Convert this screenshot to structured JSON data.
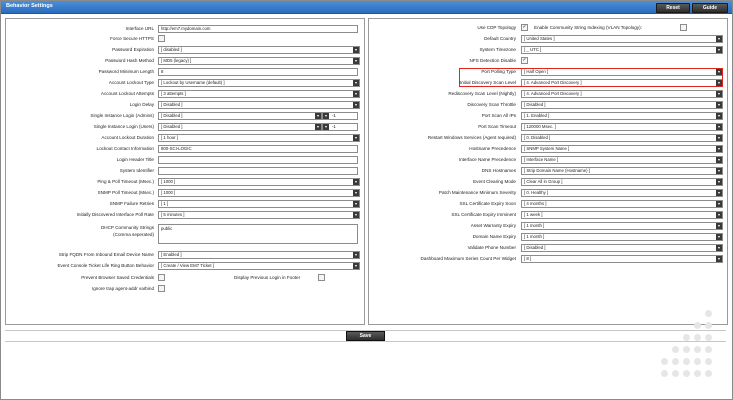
{
  "window": {
    "title": "Behavior Settings",
    "reset_label": "Reset",
    "guide_label": "Guide"
  },
  "left": {
    "interface_url": {
      "label": "Interface URL",
      "value": "http://em7.mydomain.com"
    },
    "force_https": {
      "label": "Force Secure HTTPS"
    },
    "password_expiration": {
      "label": "Password Expiration",
      "value": "[ disabled ]"
    },
    "password_hash": {
      "label": "Password Hash Method",
      "value": "[ MD5 (legacy) ]"
    },
    "password_min_length": {
      "label": "Password Minimum Length",
      "value": "8"
    },
    "account_lockout_type": {
      "label": "Account Lockout Type",
      "value": "[ Lockout by Username (default) ]"
    },
    "account_lockout_attempts": {
      "label": "Account Lockout Attempts",
      "value": "[ 3 attempts ]"
    },
    "login_delay": {
      "label": "Login Delay",
      "value": "[ Disabled ]"
    },
    "single_login_admins": {
      "label": "Single Instance Login (Admins)",
      "value": "[ Disabled ]",
      "extra": "-1"
    },
    "single_login_users": {
      "label": "Single Instance Login (Users)",
      "value": "[ Disabled ]",
      "extra": "-1"
    },
    "account_lockout_duration": {
      "label": "Account Lockout Duration",
      "value": "[ 1 hour ]"
    },
    "lockout_contact": {
      "label": "Lockout Contact Information",
      "value": "800-SCI-LOGIC"
    },
    "login_header_title": {
      "label": "Login Header Title",
      "value": ""
    },
    "system_identifier": {
      "label": "System Identifier",
      "value": ""
    },
    "ping_timeout": {
      "label": "Ping & Poll Timeout (Msec.)",
      "value": "[ 1000 ]"
    },
    "snmp_timeout": {
      "label": "SNMP Poll Timeout (Msec.)",
      "value": "[ 1000 ]"
    },
    "snmp_retries": {
      "label": "SNMP Failure Retries",
      "value": "[ 1 ]"
    },
    "poll_rate": {
      "label": "Initially Discovered Interface Poll Rate",
      "value": "[ 5 minutes ]"
    },
    "dhcp_strings": {
      "label": "DHCP Community Strings",
      "label2": "(Comma seperated)",
      "value": "public"
    },
    "strip_fqdn": {
      "label": "Strip FQDN From Inbound Email Device Name",
      "value": "[ Enabled ]"
    },
    "event_console": {
      "label": "Event Console Ticket Life Ring Button Behavior",
      "value": "[ Create / View EM7 Ticket ]"
    },
    "prevent_browser": {
      "label": "Prevent Browser Saved Credentials"
    },
    "display_prev_login": {
      "label": "Display Previous Login in Footer"
    },
    "ignore_trap": {
      "label": "Ignore trap agent-addr varbind"
    }
  },
  "right": {
    "use_cdp": {
      "label": "Use CDP Topology",
      "checked_mark": "✓"
    },
    "community_indexing": {
      "label": "Enable Community String Indexing (VLAN Topology):"
    },
    "default_country": {
      "label": "Default Country",
      "value": "[ United States ]"
    },
    "system_timezone": {
      "label": "System Timezone",
      "value": "[ _ UTC ]"
    },
    "nfs_detection": {
      "label": "NFS Detection Disable",
      "checked_mark": "✓"
    },
    "port_polling": {
      "label": "Port Polling Type",
      "value": "[ Half Open ]"
    },
    "initial_scan": {
      "label": "Initial Discovery Scan Level",
      "value": "[ 4. Advanced Port Discovery ]"
    },
    "rediscovery_scan": {
      "label": "Rediscovery Scan Level (Nightly)",
      "value": "[ 4. Advanced Port Discovery ]"
    },
    "scan_throttle": {
      "label": "Discovery Scan Throttle",
      "value": "[ Disabled ]"
    },
    "port_scan_ips": {
      "label": "Port Scan All IPs",
      "value": "[ 1. Enabled ]"
    },
    "port_scan_timeout": {
      "label": "Port Scan Timeout",
      "value": "[ 120000 Msec. ]"
    },
    "restart_windows": {
      "label": "Restart Windows Services (Agent required)",
      "value": "[ 0. Disabled ]"
    },
    "hostname_precedence": {
      "label": "Hostname Precedence",
      "value": "[ SNMP System Name ]"
    },
    "interface_precedence": {
      "label": "Interface Name Precedence",
      "value": "[ Interface Name ]"
    },
    "dns_hostnames": {
      "label": "DNS Hostnames",
      "value": "[ Strip Domain Name (Hostname) ]"
    },
    "event_clearing": {
      "label": "Event Clearing Mode",
      "value": "[ Clear All in Group ]"
    },
    "patch_severity": {
      "label": "Patch Maintenance Minimum Severity",
      "value": "[ 0. Healthy ]"
    },
    "ssl_soon": {
      "label": "SSL Certificate Expiry Soon",
      "value": "[ 4 months ]"
    },
    "ssl_imminent": {
      "label": "SSL Certificate Expiry Imminent",
      "value": "[ 1 week ]"
    },
    "asset_warranty": {
      "label": "Asset Warranty Expiry",
      "value": "[ 1 month ]"
    },
    "domain_expiry": {
      "label": "Domain Name Expiry",
      "value": "[ 1 month ]"
    },
    "validate_phone": {
      "label": "Validate Phone Number",
      "value": "[ Disabled ]"
    },
    "dashboard_max": {
      "label": "Dashboard Maximum Series Count Per Widget",
      "value": "[ 8 ]"
    }
  },
  "footer": {
    "save_label": "Save"
  },
  "icons": {
    "dropdown_arrow": "▾"
  },
  "colors": {
    "titlebar": "#2b6cbf",
    "highlight": "#e0251f"
  }
}
